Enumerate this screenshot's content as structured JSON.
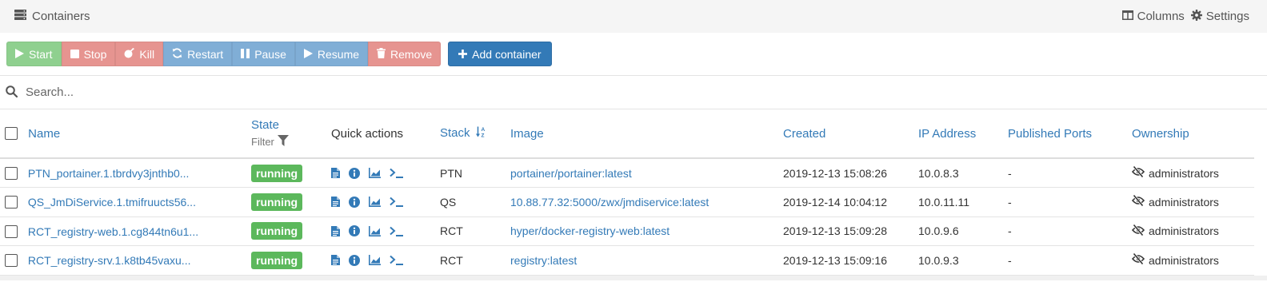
{
  "header": {
    "title": "Containers",
    "columns_label": "Columns",
    "settings_label": "Settings"
  },
  "toolbar": {
    "start": "Start",
    "stop": "Stop",
    "kill": "Kill",
    "restart": "Restart",
    "pause": "Pause",
    "resume": "Resume",
    "remove": "Remove",
    "add_container": "Add container"
  },
  "search": {
    "placeholder": "Search..."
  },
  "table": {
    "headers": {
      "name": "Name",
      "state": "State",
      "state_filter": "Filter",
      "quick_actions": "Quick actions",
      "stack": "Stack",
      "image": "Image",
      "created": "Created",
      "ip": "IP Address",
      "ports": "Published Ports",
      "ownership": "Ownership"
    },
    "rows": [
      {
        "name": "PTN_portainer.1.tbrdvy3jnthb0...",
        "state": "running",
        "stack": "PTN",
        "image": "portainer/portainer:latest",
        "created": "2019-12-13 15:08:26",
        "ip": "10.0.8.3",
        "ports": "-",
        "ownership": "administrators"
      },
      {
        "name": "QS_JmDiService.1.tmifruucts56...",
        "state": "running",
        "stack": "QS",
        "image": "10.88.77.32:5000/zwx/jmdiservice:latest",
        "created": "2019-12-14 10:04:12",
        "ip": "10.0.11.11",
        "ports": "-",
        "ownership": "administrators"
      },
      {
        "name": "RCT_registry-web.1.cg844tn6u1...",
        "state": "running",
        "stack": "RCT",
        "image": "hyper/docker-registry-web:latest",
        "created": "2019-12-13 15:09:28",
        "ip": "10.0.9.6",
        "ports": "-",
        "ownership": "administrators"
      },
      {
        "name": "RCT_registry-srv.1.k8tb45vaxu...",
        "state": "running",
        "stack": "RCT",
        "image": "registry:latest",
        "created": "2019-12-13 15:09:16",
        "ip": "10.0.9.3",
        "ports": "-",
        "ownership": "administrators"
      }
    ]
  },
  "colors": {
    "link": "#337ab7",
    "running_badge": "#5cb85c",
    "btn_success": "#8fd08f",
    "btn_danger": "#e69490",
    "btn_primary": "#80aed6",
    "btn_add": "#337ab7"
  },
  "icons": {
    "header": "server-icon",
    "columns": "columns-icon",
    "settings": "gear-icon",
    "search": "search-icon",
    "filter": "filter-icon",
    "sort": "sort-alpha-icon",
    "quick_actions": [
      "logs-icon",
      "info-icon",
      "stats-icon",
      "console-icon"
    ],
    "ownership": "eye-slash-icon"
  }
}
